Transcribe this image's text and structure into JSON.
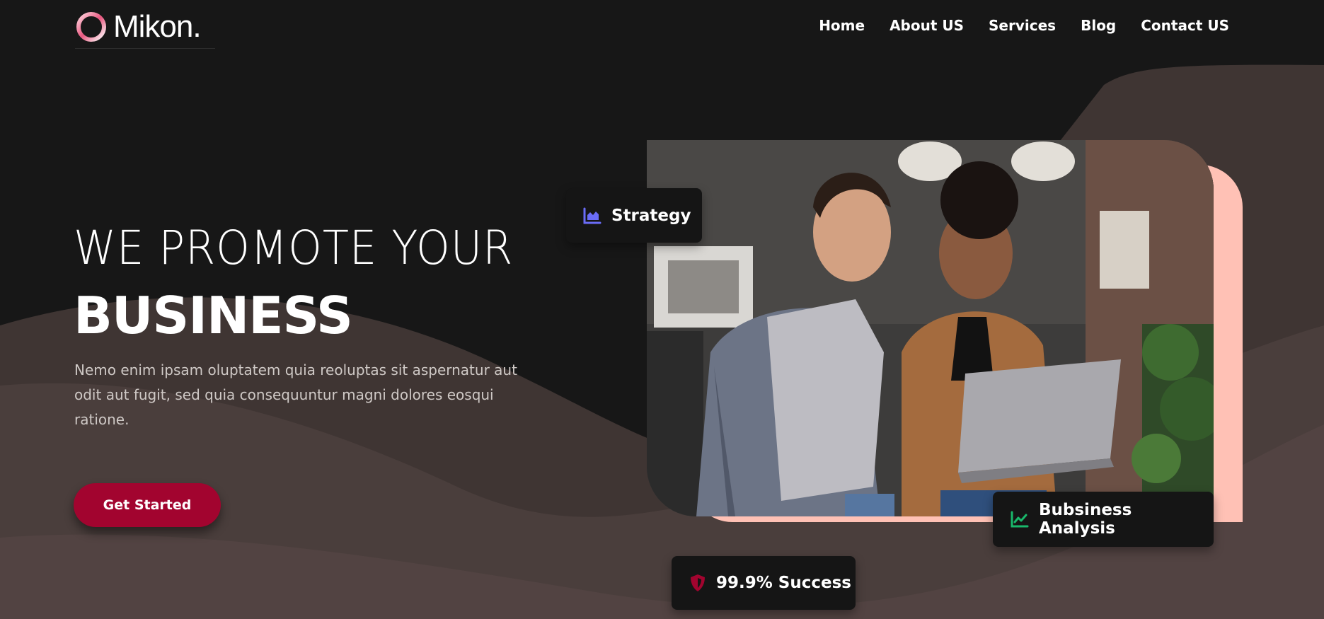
{
  "brand": {
    "name": "Mikon."
  },
  "nav": {
    "items": [
      {
        "label": "Home"
      },
      {
        "label": "About US"
      },
      {
        "label": "Services"
      },
      {
        "label": "Blog"
      },
      {
        "label": "Contact US"
      }
    ]
  },
  "hero": {
    "title_line1": "WE PROMOTE YOUR",
    "title_line2": "BUSINESS",
    "description": "Nemo enim ipsam oluptatem quia reoluptas sit aspernatur aut odit aut fugit, sed quia consequuntur magni dolores eosqui ratione.",
    "cta_label": "Get Started"
  },
  "badges": {
    "strategy": {
      "label": "Strategy",
      "icon": "area-chart-icon"
    },
    "analysis": {
      "label": "Bubsiness Analysis",
      "icon": "line-chart-icon"
    },
    "success": {
      "label": "99.9% Success",
      "icon": "shield-icon"
    }
  },
  "colors": {
    "background": "#171717",
    "wave": "#4a3e3c",
    "accent": "#a2042f",
    "photo_frame": "#ffc1b5",
    "strategy_icon": "#6a6cf6",
    "analysis_icon": "#19b86b",
    "success_icon": "#a2042f"
  }
}
